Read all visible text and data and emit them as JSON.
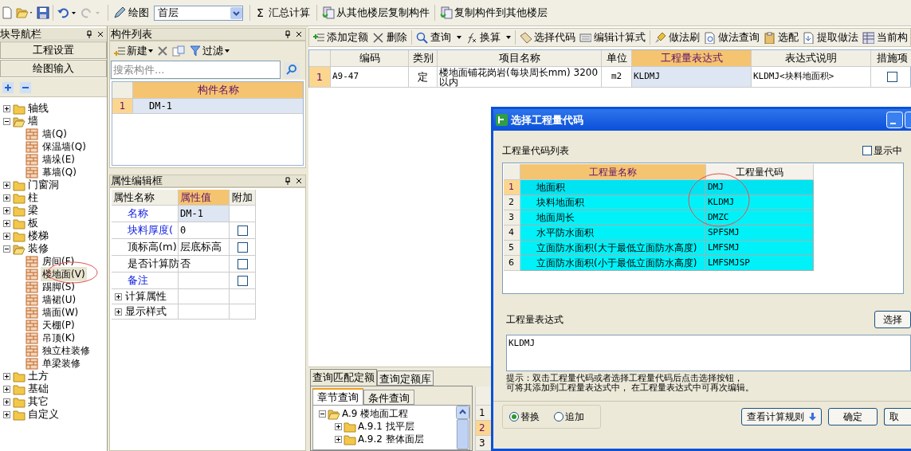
{
  "toolbar": {
    "draw_label": "绘图",
    "floor": "首层",
    "sum_icon": "Σ",
    "sum_label": "汇总计算",
    "buttons": [
      "从其他楼层复制构件",
      "复制构件到其他楼层"
    ]
  },
  "nav": {
    "title": "块导航栏",
    "buttons": [
      "工程设置",
      "绘图输入"
    ],
    "tree": [
      {
        "label": "轴线",
        "expanded": false
      },
      {
        "label": "墙",
        "expanded": true,
        "children": [
          {
            "label": "墙(Q)",
            "selected": false
          },
          {
            "label": "保温墙(Q)",
            "selected": false
          },
          {
            "label": "墙垛(E)",
            "selected": false
          },
          {
            "label": "幕墙(Q)",
            "selected": false
          }
        ]
      },
      {
        "label": "门窗洞",
        "expanded": false
      },
      {
        "label": "柱",
        "expanded": false
      },
      {
        "label": "梁",
        "expanded": false
      },
      {
        "label": "板",
        "expanded": false
      },
      {
        "label": "楼梯",
        "expanded": false
      },
      {
        "label": "装修",
        "expanded": true,
        "children": [
          {
            "label": "房间(F)",
            "selected": false
          },
          {
            "label": "楼地面(V)",
            "selected": true
          },
          {
            "label": "踢脚(S)",
            "selected": false
          },
          {
            "label": "墙裙(U)",
            "selected": false
          },
          {
            "label": "墙面(W)",
            "selected": false
          },
          {
            "label": "天棚(P)",
            "selected": false
          },
          {
            "label": "吊顶(K)",
            "selected": false
          },
          {
            "label": "独立柱装修",
            "selected": false
          },
          {
            "label": "单梁装修",
            "selected": false
          }
        ]
      },
      {
        "label": "土方",
        "expanded": false
      },
      {
        "label": "基础",
        "expanded": false
      },
      {
        "label": "其它",
        "expanded": false
      },
      {
        "label": "自定义",
        "expanded": false
      }
    ]
  },
  "component_list": {
    "title": "构件列表",
    "new_label": "新建",
    "filter_label": "过滤",
    "search_placeholder": "搜索构件...",
    "column": "构件名称",
    "rows": [
      {
        "index": "1",
        "name": "DM-1",
        "selected": true
      }
    ]
  },
  "properties": {
    "title": "属性编辑框",
    "columns": [
      "属性名称",
      "属性值",
      "附加"
    ],
    "rows": [
      {
        "kind": "prop",
        "name": "名称",
        "value": "DM-1",
        "blue": true
      },
      {
        "kind": "prop",
        "name": "块料厚度(",
        "value": "0",
        "blue": true,
        "checked": false
      },
      {
        "kind": "prop",
        "name": "顶标高(m)",
        "value": "层底标高",
        "blue": false,
        "checked": false
      },
      {
        "kind": "prop",
        "name": "是否计算防",
        "value": "否",
        "blue": false,
        "checked": false
      },
      {
        "kind": "prop",
        "name": "备注",
        "blue": true,
        "checked": false
      },
      {
        "kind": "group",
        "name": "计算属性",
        "expanded": false
      },
      {
        "kind": "group",
        "name": "显示样式",
        "expanded": false
      }
    ]
  },
  "quota": {
    "toolbar": [
      {
        "label": "添加定额",
        "menu": false
      },
      {
        "label": "删除",
        "menu": false
      },
      {
        "label": "查询",
        "menu": true
      },
      {
        "label": "换算",
        "menu": true
      },
      {
        "label": "选择代码",
        "menu": false
      },
      {
        "label": "编辑计算式",
        "menu": false
      },
      {
        "label": "做法刷",
        "menu": false
      },
      {
        "label": "做法查询",
        "menu": false
      },
      {
        "label": "选配",
        "menu": false
      },
      {
        "label": "提取做法",
        "menu": false
      },
      {
        "label": "当前构",
        "menu": false
      }
    ],
    "columns": [
      "编码",
      "类别",
      "项目名称",
      "单位",
      "工程量表达式",
      "表达式说明",
      "措施项"
    ],
    "rows": [
      {
        "index": "1",
        "code": "A9-47",
        "type": "定",
        "name": "楼地面铺花岗岩(每块周长mm) 3200以内",
        "unit": "m2",
        "expression": "KLDMJ",
        "description": "KLDMJ<块料地面积>",
        "measure": false
      }
    ]
  },
  "lookup": {
    "tabs": [
      {
        "label": "查询匹配定额",
        "selected": true
      },
      {
        "label": "查询定额库",
        "selected": false
      }
    ],
    "subtabs": [
      {
        "label": "章节查询",
        "selected": true
      },
      {
        "label": "条件查询",
        "selected": false
      }
    ],
    "tree": [
      {
        "label": "A.9 楼地面工程",
        "expanded": true,
        "children": [
          {
            "label": "A.9.1 找平层",
            "expanded": false
          },
          {
            "label": "A.9.2 整体面层",
            "expanded": false
          }
        ]
      }
    ],
    "side_rows": [
      {
        "index": "1",
        "selected": false
      },
      {
        "index": "2",
        "selected": true
      },
      {
        "index": "3",
        "selected": false
      }
    ]
  },
  "dialog": {
    "title": "选择工程量代码",
    "list_label": "工程量代码列表",
    "show_middle": {
      "label": "显示中",
      "checked": false
    },
    "columns": [
      "工程量名称",
      "工程量代码"
    ],
    "rows": [
      {
        "index": "1",
        "name": "地面积",
        "code": "DMJ",
        "selected": true
      },
      {
        "index": "2",
        "name": "块料地面积",
        "code": "KLDMJ",
        "selected": false
      },
      {
        "index": "3",
        "name": "地面周长",
        "code": "DMZC",
        "selected": false
      },
      {
        "index": "4",
        "name": "水平防水面积",
        "code": "SPFSMJ",
        "selected": false
      },
      {
        "index": "5",
        "name": "立面防水面积(大于最低立面防水高度)",
        "code": "LMFSMJ",
        "selected": false
      },
      {
        "index": "6",
        "name": "立面防水面积(小于最低立面防水高度)",
        "code": "LMFSMJSP",
        "selected": false
      }
    ],
    "expression_label": "工程量表达式",
    "select_button": "选择",
    "expression": "KLDMJ",
    "hint": [
      "提示：双击工程量代码或者选择工程量代码后点击选择按钮，",
      "可将其添加到工程量表达式中， 在工程量表达式中可再次编辑。"
    ],
    "modes": [
      {
        "label": "替换",
        "selected": true
      },
      {
        "label": "追加",
        "selected": false
      }
    ],
    "rules_button": "查看计算规则",
    "ok_button": "确定",
    "cancel_button": "取"
  }
}
